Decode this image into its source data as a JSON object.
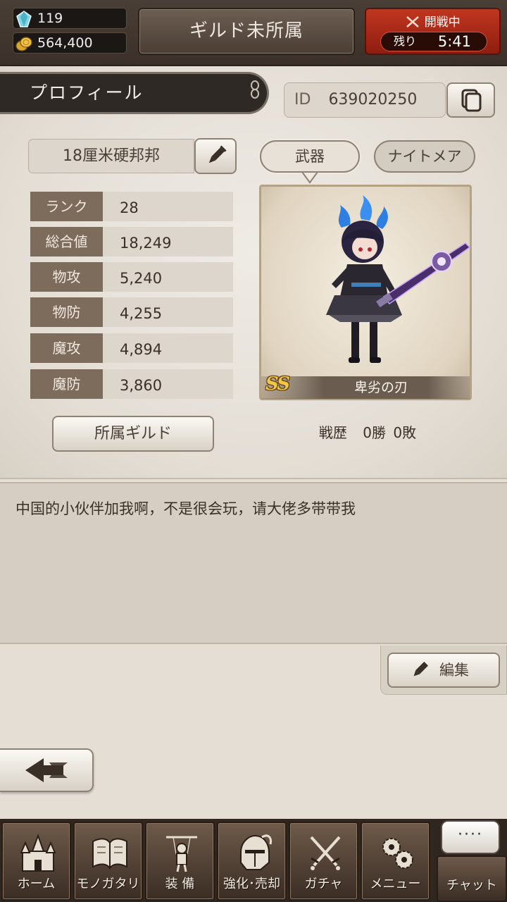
{
  "header": {
    "gems": "119",
    "coins": "564,400",
    "guild_status": "ギルド未所属",
    "battle": {
      "title": "開戦中",
      "remain_label": "残り",
      "remain_time": "5:41"
    }
  },
  "profile": {
    "tab_label": "プロフィール",
    "id_label": "ID",
    "id_value": "639020250",
    "name": "18厘米硬邦邦",
    "stats": [
      {
        "label": "ランク",
        "value": "28"
      },
      {
        "label": "総合値",
        "value": "18,249"
      },
      {
        "label": "物攻",
        "value": "5,240"
      },
      {
        "label": "物防",
        "value": "4,255"
      },
      {
        "label": "魔攻",
        "value": "4,894"
      },
      {
        "label": "魔防",
        "value": "3,860"
      }
    ],
    "guild_button": "所属ギルド",
    "tabs": {
      "weapon": "武器",
      "nightmare": "ナイトメア"
    },
    "weapon": {
      "rarity": "SS",
      "name": "卑劣の刃"
    },
    "record": {
      "label": "戦歴",
      "wins": "0勝",
      "losses": "0敗"
    }
  },
  "comment": {
    "text": "中国的小伙伴加我啊，不是很会玩，请大佬多带带我",
    "edit_button": "編集"
  },
  "nav": {
    "items": [
      {
        "label": "ホーム",
        "icon": "castle-icon"
      },
      {
        "label": "モノガタリ",
        "icon": "book-icon"
      },
      {
        "label": "装 備",
        "icon": "puppet-icon"
      },
      {
        "label": "強化･売却",
        "icon": "helmet-icon"
      },
      {
        "label": "ガチャ",
        "icon": "crossed-swords-icon"
      },
      {
        "label": "メニュー",
        "icon": "gears-icon"
      }
    ],
    "chat": {
      "label": "チャット",
      "dots": "····"
    }
  }
}
